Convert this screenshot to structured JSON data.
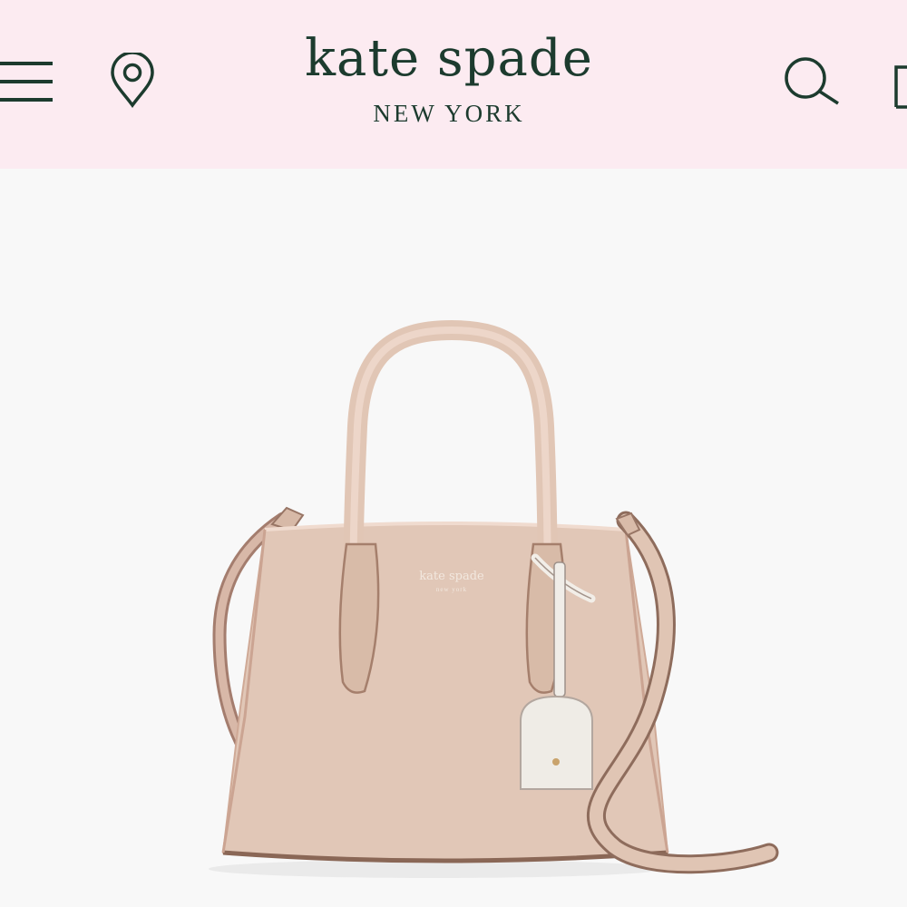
{
  "header": {
    "brand_name": "kate spade",
    "brand_sub": "NEW YORK",
    "icons": [
      "menu-icon",
      "location-pin-icon",
      "search-icon",
      "shopping-bag-icon"
    ],
    "background_color": "#fcebf1",
    "text_color": "#1c3b2e"
  },
  "product": {
    "embossed_brand": "kate spade",
    "embossed_sub": "new york",
    "bag_color": "#e1c7b7",
    "tag_color": "#efece6"
  }
}
